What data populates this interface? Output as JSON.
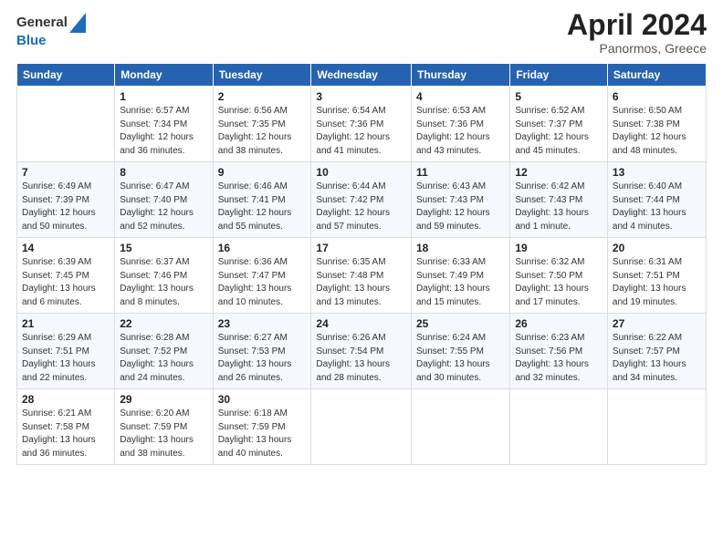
{
  "logo": {
    "general": "General",
    "blue": "Blue"
  },
  "title": "April 2024",
  "subtitle": "Panormos, Greece",
  "weekdays": [
    "Sunday",
    "Monday",
    "Tuesday",
    "Wednesday",
    "Thursday",
    "Friday",
    "Saturday"
  ],
  "weeks": [
    [
      {
        "day": "",
        "sunrise": "",
        "sunset": "",
        "daylight": ""
      },
      {
        "day": "1",
        "sunrise": "Sunrise: 6:57 AM",
        "sunset": "Sunset: 7:34 PM",
        "daylight": "Daylight: 12 hours and 36 minutes."
      },
      {
        "day": "2",
        "sunrise": "Sunrise: 6:56 AM",
        "sunset": "Sunset: 7:35 PM",
        "daylight": "Daylight: 12 hours and 38 minutes."
      },
      {
        "day": "3",
        "sunrise": "Sunrise: 6:54 AM",
        "sunset": "Sunset: 7:36 PM",
        "daylight": "Daylight: 12 hours and 41 minutes."
      },
      {
        "day": "4",
        "sunrise": "Sunrise: 6:53 AM",
        "sunset": "Sunset: 7:36 PM",
        "daylight": "Daylight: 12 hours and 43 minutes."
      },
      {
        "day": "5",
        "sunrise": "Sunrise: 6:52 AM",
        "sunset": "Sunset: 7:37 PM",
        "daylight": "Daylight: 12 hours and 45 minutes."
      },
      {
        "day": "6",
        "sunrise": "Sunrise: 6:50 AM",
        "sunset": "Sunset: 7:38 PM",
        "daylight": "Daylight: 12 hours and 48 minutes."
      }
    ],
    [
      {
        "day": "7",
        "sunrise": "Sunrise: 6:49 AM",
        "sunset": "Sunset: 7:39 PM",
        "daylight": "Daylight: 12 hours and 50 minutes."
      },
      {
        "day": "8",
        "sunrise": "Sunrise: 6:47 AM",
        "sunset": "Sunset: 7:40 PM",
        "daylight": "Daylight: 12 hours and 52 minutes."
      },
      {
        "day": "9",
        "sunrise": "Sunrise: 6:46 AM",
        "sunset": "Sunset: 7:41 PM",
        "daylight": "Daylight: 12 hours and 55 minutes."
      },
      {
        "day": "10",
        "sunrise": "Sunrise: 6:44 AM",
        "sunset": "Sunset: 7:42 PM",
        "daylight": "Daylight: 12 hours and 57 minutes."
      },
      {
        "day": "11",
        "sunrise": "Sunrise: 6:43 AM",
        "sunset": "Sunset: 7:43 PM",
        "daylight": "Daylight: 12 hours and 59 minutes."
      },
      {
        "day": "12",
        "sunrise": "Sunrise: 6:42 AM",
        "sunset": "Sunset: 7:43 PM",
        "daylight": "Daylight: 13 hours and 1 minute."
      },
      {
        "day": "13",
        "sunrise": "Sunrise: 6:40 AM",
        "sunset": "Sunset: 7:44 PM",
        "daylight": "Daylight: 13 hours and 4 minutes."
      }
    ],
    [
      {
        "day": "14",
        "sunrise": "Sunrise: 6:39 AM",
        "sunset": "Sunset: 7:45 PM",
        "daylight": "Daylight: 13 hours and 6 minutes."
      },
      {
        "day": "15",
        "sunrise": "Sunrise: 6:37 AM",
        "sunset": "Sunset: 7:46 PM",
        "daylight": "Daylight: 13 hours and 8 minutes."
      },
      {
        "day": "16",
        "sunrise": "Sunrise: 6:36 AM",
        "sunset": "Sunset: 7:47 PM",
        "daylight": "Daylight: 13 hours and 10 minutes."
      },
      {
        "day": "17",
        "sunrise": "Sunrise: 6:35 AM",
        "sunset": "Sunset: 7:48 PM",
        "daylight": "Daylight: 13 hours and 13 minutes."
      },
      {
        "day": "18",
        "sunrise": "Sunrise: 6:33 AM",
        "sunset": "Sunset: 7:49 PM",
        "daylight": "Daylight: 13 hours and 15 minutes."
      },
      {
        "day": "19",
        "sunrise": "Sunrise: 6:32 AM",
        "sunset": "Sunset: 7:50 PM",
        "daylight": "Daylight: 13 hours and 17 minutes."
      },
      {
        "day": "20",
        "sunrise": "Sunrise: 6:31 AM",
        "sunset": "Sunset: 7:51 PM",
        "daylight": "Daylight: 13 hours and 19 minutes."
      }
    ],
    [
      {
        "day": "21",
        "sunrise": "Sunrise: 6:29 AM",
        "sunset": "Sunset: 7:51 PM",
        "daylight": "Daylight: 13 hours and 22 minutes."
      },
      {
        "day": "22",
        "sunrise": "Sunrise: 6:28 AM",
        "sunset": "Sunset: 7:52 PM",
        "daylight": "Daylight: 13 hours and 24 minutes."
      },
      {
        "day": "23",
        "sunrise": "Sunrise: 6:27 AM",
        "sunset": "Sunset: 7:53 PM",
        "daylight": "Daylight: 13 hours and 26 minutes."
      },
      {
        "day": "24",
        "sunrise": "Sunrise: 6:26 AM",
        "sunset": "Sunset: 7:54 PM",
        "daylight": "Daylight: 13 hours and 28 minutes."
      },
      {
        "day": "25",
        "sunrise": "Sunrise: 6:24 AM",
        "sunset": "Sunset: 7:55 PM",
        "daylight": "Daylight: 13 hours and 30 minutes."
      },
      {
        "day": "26",
        "sunrise": "Sunrise: 6:23 AM",
        "sunset": "Sunset: 7:56 PM",
        "daylight": "Daylight: 13 hours and 32 minutes."
      },
      {
        "day": "27",
        "sunrise": "Sunrise: 6:22 AM",
        "sunset": "Sunset: 7:57 PM",
        "daylight": "Daylight: 13 hours and 34 minutes."
      }
    ],
    [
      {
        "day": "28",
        "sunrise": "Sunrise: 6:21 AM",
        "sunset": "Sunset: 7:58 PM",
        "daylight": "Daylight: 13 hours and 36 minutes."
      },
      {
        "day": "29",
        "sunrise": "Sunrise: 6:20 AM",
        "sunset": "Sunset: 7:59 PM",
        "daylight": "Daylight: 13 hours and 38 minutes."
      },
      {
        "day": "30",
        "sunrise": "Sunrise: 6:18 AM",
        "sunset": "Sunset: 7:59 PM",
        "daylight": "Daylight: 13 hours and 40 minutes."
      },
      {
        "day": "",
        "sunrise": "",
        "sunset": "",
        "daylight": ""
      },
      {
        "day": "",
        "sunrise": "",
        "sunset": "",
        "daylight": ""
      },
      {
        "day": "",
        "sunrise": "",
        "sunset": "",
        "daylight": ""
      },
      {
        "day": "",
        "sunrise": "",
        "sunset": "",
        "daylight": ""
      }
    ]
  ]
}
